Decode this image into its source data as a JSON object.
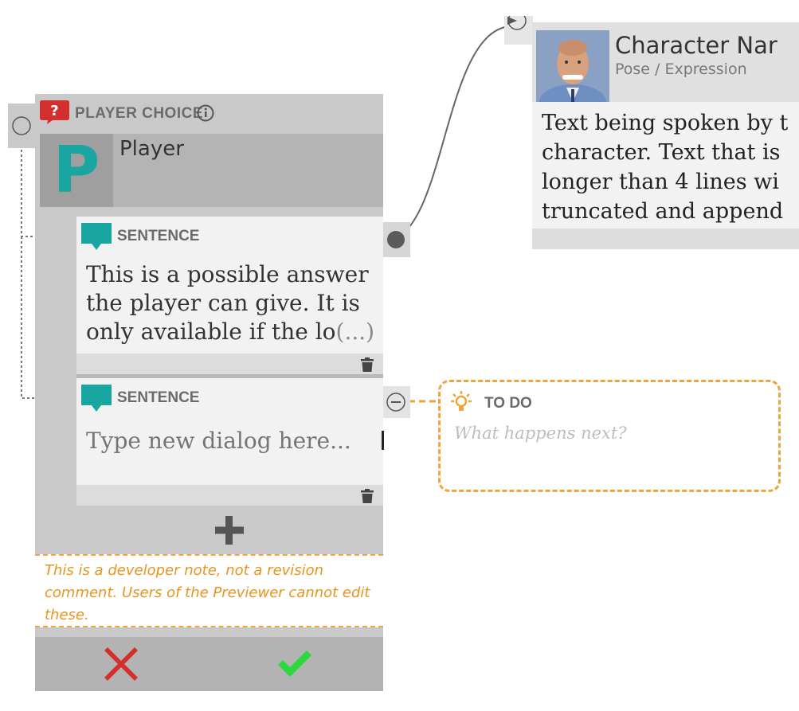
{
  "player_choice": {
    "type_label": "PLAYER CHOICE",
    "character_initial": "P",
    "character_name": "Player",
    "sentences": [
      {
        "label": "SENTENCE",
        "text": "This is a possible answer the player can give. It is only available if the lo",
        "ellipsis": "(...)"
      },
      {
        "label": "SENTENCE",
        "placeholder": "Type new dialog here..."
      }
    ],
    "developer_note": "This is a developer note, not a revision comment. Users of the Previewer cannot edit these."
  },
  "dialogue": {
    "character_name": "Character Nar",
    "pose": "Pose / Expression",
    "text_lines": [
      "Text being spoken by t",
      "character. Text that is",
      "longer than 4 lines wi",
      "truncated and append"
    ]
  },
  "todo": {
    "label": "TO DO",
    "text": "What happens next?"
  },
  "colors": {
    "accent_teal": "#1aa6a0",
    "todo_orange": "#f2a43c",
    "question_red": "#d32f2f",
    "cancel_red": "#d32f2f",
    "confirm_green": "#2bd93f"
  },
  "icons": [
    "question-icon",
    "info-icon",
    "speech-bubble-icon",
    "trash-icon",
    "plus-icon",
    "lightbulb-icon",
    "close-icon",
    "check-icon"
  ]
}
